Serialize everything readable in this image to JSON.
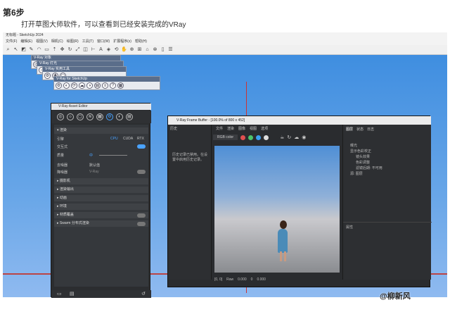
{
  "article": {
    "step_title": "第6步",
    "step_text": "打开草图大师软件，可以查看到已经安装完成的VRay",
    "watermark": "@柳新风"
  },
  "sketchup": {
    "title": "无标题 - SketchUp 2024",
    "menu": [
      "文件(F)",
      "编辑(E)",
      "视图(V)",
      "相机(C)",
      "绘图(R)",
      "工具(T)",
      "窗口(W)",
      "扩展程序(x)",
      "帮助(H)"
    ]
  },
  "vray_toolbars": {
    "t1": "V-Ray 灯光",
    "t2": "V-Ray 实用工具",
    "t3": "V-Ray for SketchUp",
    "t0": "V-Ray 对象"
  },
  "asset_editor": {
    "title": "V-Ray Asset Editor",
    "section_render": "渲染",
    "engine_label": "引擎",
    "engine_options": [
      "CPU",
      "CUDA",
      "RTX"
    ],
    "interactive_label": "交互式",
    "quality_label": "质量",
    "quality_value": "中",
    "denoise_label": "去噪器",
    "denoise_value": "默认值",
    "denoiser_label": "降噪器",
    "denoiser_value": "V-Ray",
    "sections": [
      "摄影机",
      "渲染输出",
      "动画",
      "环境",
      "材质覆盖",
      "Swarm 分布式渲染"
    ]
  },
  "frame_buffer": {
    "title": "V-Ray Frame Buffer - [100.0% of 800 x 452]",
    "menu": [
      "文件",
      "渲染",
      "图像",
      "视图",
      "选项"
    ],
    "left_head": "历史",
    "left_msg": "历史记录已禁用。在设置中启用历史记录。",
    "channel": "RGB color",
    "right_tabs": [
      "图层",
      "状态",
      "日志"
    ],
    "layers": [
      "曝光",
      "显示色彩校正",
      "镜头效果",
      "色彩调整",
      "滤镜后期: 不可用",
      "源: 图层"
    ],
    "props_label": "属性",
    "bottom_values": [
      "[0, 0]",
      "Raw",
      "0.000",
      "0",
      "0.000"
    ]
  },
  "colors": {
    "accent": "#2f7fd8"
  }
}
